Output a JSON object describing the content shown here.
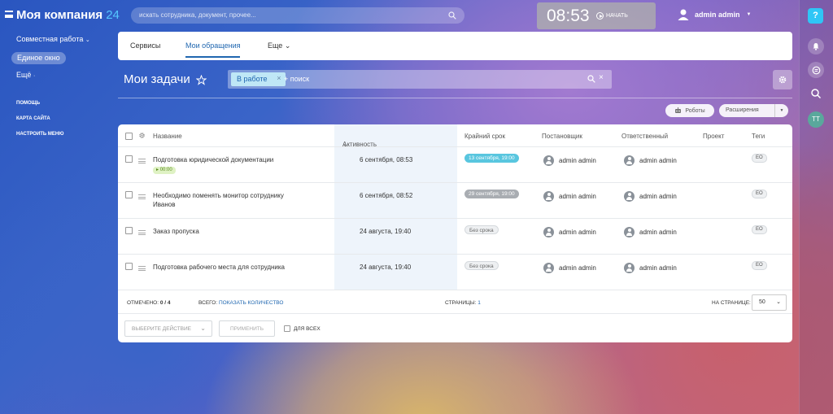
{
  "header": {
    "logo_name": "Моя компания",
    "logo_num": "24",
    "search_placeholder": "искать сотрудника, документ, прочее...",
    "time": "08:53",
    "start_label": "НАЧАТЬ",
    "user_name": "admin admin"
  },
  "leftnav": {
    "items": [
      "Совместная работа",
      "Единое окно",
      "Ещё"
    ],
    "links": [
      "ПОМОЩЬ",
      "КАРТА САЙТА",
      "НАСТРОИТЬ МЕНЮ"
    ]
  },
  "tabs": [
    "Сервисы",
    "Мои обращения",
    "Еще"
  ],
  "page_title": "Мои задачи",
  "filter": {
    "chip": "В работе",
    "placeholder": "+ поиск"
  },
  "buttons": {
    "robots": "Роботы",
    "extensions": "Расширения"
  },
  "columns": [
    "Название",
    "Активность",
    "Крайний срок",
    "Постановщик",
    "Ответственный",
    "Проект",
    "Теги"
  ],
  "rows": [
    {
      "name": "Подготовка юридической документации",
      "timer": "00:00",
      "activity": "6 сентября, 08:53",
      "deadline": "13 сентября, 19:00",
      "deadline_color": "#59c6df",
      "creator": "admin admin",
      "responsible": "admin admin",
      "tag": "ЕО"
    },
    {
      "name": "Необходимо поменять монитор сотруднику Иванов",
      "timer": "",
      "activity": "6 сентября, 08:52",
      "deadline": "29 сентября, 19:00",
      "deadline_color": "#a9adb2",
      "creator": "admin admin",
      "responsible": "admin admin",
      "tag": "ЕО"
    },
    {
      "name": "Заказ пропуска",
      "timer": "",
      "activity": "24 августа, 19:40",
      "deadline": "Без срока",
      "deadline_color": "",
      "creator": "admin admin",
      "responsible": "admin admin",
      "tag": "ЕО"
    },
    {
      "name": "Подготовка рабочего места для сотрудника",
      "timer": "",
      "activity": "24 августа, 19:40",
      "deadline": "Без срока",
      "deadline_color": "",
      "creator": "admin admin",
      "responsible": "admin admin",
      "tag": "ЕО"
    }
  ],
  "footer": {
    "marked_label": "ОТМЕЧЕНО:",
    "marked_value": "0 / 4",
    "total_label": "ВСЕГО:",
    "total_link": "ПОКАЗАТЬ КОЛИЧЕСТВО",
    "pages_label": "СТРАНИЦЫ:",
    "pages_value": "1",
    "per_page_label": "НА СТРАНИЦЕ:",
    "per_page_value": "50"
  },
  "actions": {
    "select_action": "ВЫБЕРИТЕ ДЕЙСТВИЕ",
    "apply": "ПРИМЕНИТЬ",
    "for_all": "ДЛЯ ВСЕХ"
  },
  "rightbar": {
    "help": "?",
    "avatar": "ТТ"
  },
  "colors": {
    "accent": "#2067b0",
    "logo_num": "#55c8ff",
    "help": "#2fc6f6"
  }
}
